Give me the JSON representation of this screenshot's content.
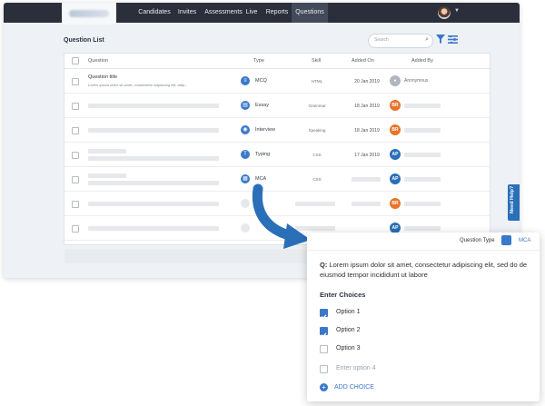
{
  "nav": {
    "items": [
      "Candidates",
      "Invites",
      "Assessments",
      "Live",
      "Reports",
      "Questions"
    ],
    "active": "Questions"
  },
  "question_list": {
    "title": "Question List",
    "search_placeholder": "Search",
    "columns": [
      "Question",
      "Type",
      "Skill",
      "Added On",
      "Added By"
    ],
    "rows": [
      {
        "title": "Question title",
        "subtitle": "Lorem ipsum dolor sit amet, consectetur adipiscing elit, adip...",
        "type": "MCQ",
        "type_icon": "list-icon",
        "skill": "HTML",
        "added_on": "20 Jan 2019",
        "added_by_initials": "",
        "added_by_name": "Anonymous",
        "badge_color": "#b0b6bd"
      },
      {
        "title": "",
        "subtitle": "",
        "type": "Essay",
        "type_icon": "document-icon",
        "skill": "Grammar",
        "added_on": "18 Jan 2019",
        "added_by_initials": "BR",
        "added_by_name": "",
        "badge_color": "#e8742b"
      },
      {
        "title": "",
        "subtitle": "",
        "type": "Interview",
        "type_icon": "camera-icon",
        "skill": "Speaking",
        "added_on": "18 Jan 2019",
        "added_by_initials": "BR",
        "added_by_name": "",
        "badge_color": "#e8742b"
      },
      {
        "title": "",
        "subtitle": "",
        "type": "Typing",
        "type_icon": "text-icon",
        "skill": "CSS",
        "added_on": "17 Jan 2019",
        "added_by_initials": "AP",
        "added_by_name": "",
        "badge_color": "#2a6fb8"
      },
      {
        "title": "",
        "subtitle": "",
        "type": "MCA",
        "type_icon": "checklist-icon",
        "skill": "CSS",
        "added_on": "",
        "added_by_initials": "AP",
        "added_by_name": "",
        "badge_color": "#2a6fb8"
      },
      {
        "title": "",
        "subtitle": "",
        "type": "",
        "type_icon": "",
        "skill": "",
        "added_on": "",
        "added_by_initials": "BR",
        "added_by_name": "",
        "badge_color": "#e8742b"
      },
      {
        "title": "",
        "subtitle": "",
        "type": "",
        "type_icon": "",
        "skill": "",
        "added_on": "",
        "added_by_initials": "AP",
        "added_by_name": "",
        "badge_color": "#2a6fb8"
      }
    ]
  },
  "need_help": "Need Help?",
  "detail": {
    "question_type_label": "Question Type",
    "question_type_value": "MCA",
    "question_prefix": "Q:",
    "question_text": "Lorem ipsum dolor sit amet, consectetur adipiscing elit, sed do de eiusmod tempor incididunt ut labore",
    "choices_title": "Enter Choices",
    "options": [
      {
        "label": "Option 1",
        "checked": true
      },
      {
        "label": "Option 2",
        "checked": true
      },
      {
        "label": "Option 3",
        "checked": false
      },
      {
        "label": "Enter option 4",
        "checked": false,
        "placeholder": true
      }
    ],
    "add_choice": "ADD CHOICE"
  },
  "colors": {
    "accent": "#3a78c9",
    "topbar": "#2a2f3b",
    "orange": "#e8742b"
  }
}
